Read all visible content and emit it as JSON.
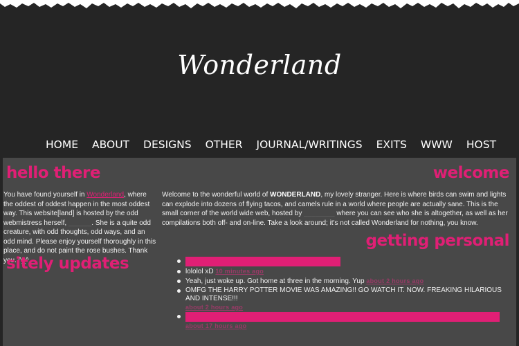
{
  "header": {
    "title": "Wonderland"
  },
  "nav": {
    "items": [
      "HOME",
      "ABOUT",
      "DESIGNS",
      "OTHER",
      "JOURNAL/WRITINGS",
      "EXITS",
      "WWW",
      "HOST"
    ]
  },
  "hello": {
    "heading": "hello there",
    "text_before": "You have found yourself in ",
    "link": "Wonderland",
    "text_after": ", where the oddest of oddest happen in the most oddest way. This website[land] is hosted by the odd webmistress herself, ",
    "hidden_name": "______",
    "text_end": ". She is a quite odd creature, with odd thoughts, odd ways, and an odd mind. Please enjoy yourself thoroughly in this place, and do not paint the rose bushes. Thank you. ^_^"
  },
  "sitely": {
    "heading": "sitely updates"
  },
  "welcome": {
    "heading": "welcome",
    "text_before": "Welcome to the wonderful world of ",
    "bold": "WONDERLAND",
    "text_middle": ", my lovely stranger. Here is where birds can swim and lights can explode into dozens of flying tacos, and camels rule in a world where people are actually sane. This is the small corner of the world wide web, hosted by ",
    "hidden_name": "________",
    "text_after": " where you can see who she is altogether, as well as her compilations both off- and on-line. Take a look around; it's not called Wonderland for nothing, you know."
  },
  "personal": {
    "heading": "getting personal",
    "updates": [
      {
        "text": "",
        "time": ""
      },
      {
        "text": "lololol xD",
        "time": "10 minutes ago"
      },
      {
        "text": "Yeah, just woke up. Got home at three in the morning. Yup",
        "time": "about 2 hours ago"
      },
      {
        "text": "OMFG THE HARRY POTTER MOVIE WAS AMAZING!! GO WATCH IT. NOW. FREAKING HILARIOUS AND INTENSE!!!",
        "time": "about 2 hours ago"
      },
      {
        "text": "",
        "time": "about 17 hours ago"
      }
    ]
  },
  "colors": {
    "accent": "#e01f75",
    "background": "#252525",
    "panel": "#484848"
  }
}
